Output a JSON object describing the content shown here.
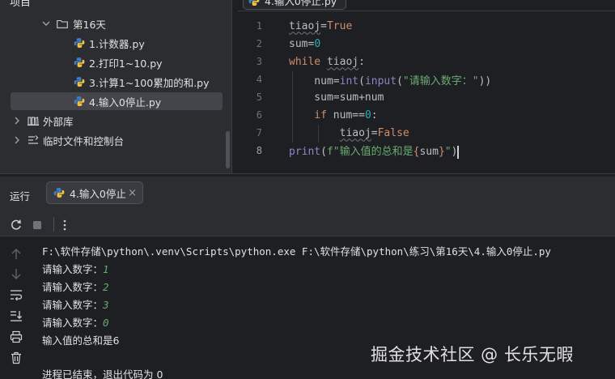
{
  "project": {
    "title": "项目",
    "items": [
      {
        "label": "第16天",
        "kind": "folder"
      },
      {
        "label": "1.计数器.py",
        "kind": "py"
      },
      {
        "label": "2.打印1~10.py",
        "kind": "py"
      },
      {
        "label": "3.计算1~100累加的和.py",
        "kind": "py"
      },
      {
        "label": "4.输入0停止.py",
        "kind": "py",
        "selected": true
      },
      {
        "label": "外部库",
        "kind": "library"
      },
      {
        "label": "临时文件和控制台",
        "kind": "scratch"
      }
    ]
  },
  "editor": {
    "tab_label": "4.输入0停止.py",
    "lines": [
      {
        "n": "1",
        "tokens": [
          [
            "id w",
            "tiaoj"
          ],
          [
            "id",
            "="
          ],
          [
            "kw",
            "True"
          ]
        ]
      },
      {
        "n": "2",
        "tokens": [
          [
            "id",
            "sum="
          ],
          [
            "num",
            "0"
          ]
        ]
      },
      {
        "n": "3",
        "tokens": [
          [
            "kw",
            "while "
          ],
          [
            "id w",
            "tiaoj"
          ],
          [
            "id",
            ":"
          ]
        ]
      },
      {
        "n": "4",
        "tokens": [
          [
            "id",
            "    num="
          ],
          [
            "fn",
            "int"
          ],
          [
            "id",
            "("
          ],
          [
            "fn",
            "input"
          ],
          [
            "id",
            "("
          ],
          [
            "str",
            "\"请输入数字：\""
          ],
          [
            "id",
            "))"
          ]
        ]
      },
      {
        "n": "5",
        "tokens": [
          [
            "id",
            "    sum=sum+num"
          ]
        ]
      },
      {
        "n": "6",
        "tokens": [
          [
            "kw",
            "    if "
          ],
          [
            "id",
            "num=="
          ],
          [
            "num",
            "0"
          ],
          [
            "id",
            ":"
          ]
        ]
      },
      {
        "n": "7",
        "tokens": [
          [
            "id",
            "        "
          ],
          [
            "id w",
            "tiaoj"
          ],
          [
            "id",
            "="
          ],
          [
            "kw",
            "False"
          ]
        ]
      },
      {
        "n": "8",
        "tokens": [
          [
            "fn",
            "print"
          ],
          [
            "id",
            "("
          ],
          [
            "str",
            "f\"输入值的总和是"
          ],
          [
            "kw",
            "{"
          ],
          [
            "id",
            "sum"
          ],
          [
            "kw",
            "}"
          ],
          [
            "str",
            "\""
          ],
          [
            "id",
            ")"
          ]
        ]
      }
    ]
  },
  "run": {
    "title": "运行",
    "tab_label": "4.输入0停止",
    "close": "×",
    "console": {
      "command": "F:\\软件存储\\python\\.venv\\Scripts\\python.exe F:\\软件存储\\python\\练习\\第16天\\4.输入0停止.py",
      "prompts": [
        {
          "prompt": "请输入数字：",
          "value": "1"
        },
        {
          "prompt": "请输入数字：",
          "value": "2"
        },
        {
          "prompt": "请输入数字：",
          "value": "3"
        },
        {
          "prompt": "请输入数字：",
          "value": "0"
        }
      ],
      "result": "输入值的总和是6",
      "exit": "进程已结束，退出代码为 0"
    }
  },
  "watermark": "掘金技术社区 @ 长乐无暇",
  "colors": {
    "keyword": "#cf8e6d",
    "number": "#2aacb8",
    "string": "#6aab73",
    "builtin": "#8888c6",
    "identifier": "#bcbec4",
    "user_input": "#6aab73"
  }
}
